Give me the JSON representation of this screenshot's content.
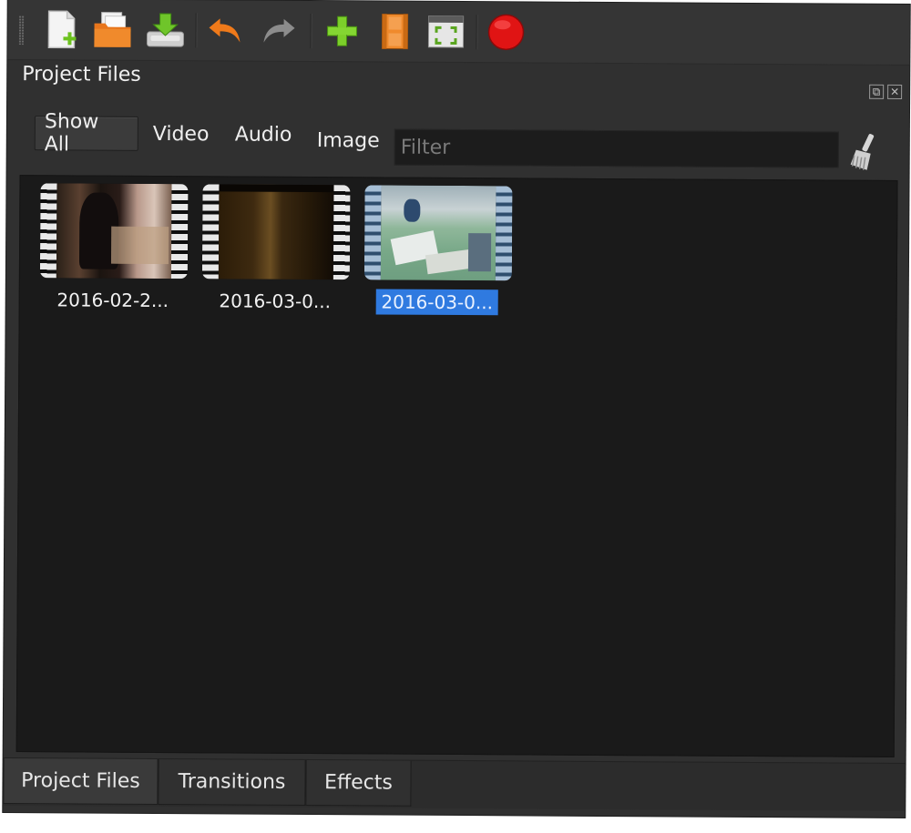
{
  "toolbar": {
    "buttons": [
      {
        "name": "new-project",
        "icon": "new-file-icon"
      },
      {
        "name": "open-project",
        "icon": "open-folder-icon"
      },
      {
        "name": "save-project",
        "icon": "save-download-icon"
      },
      {
        "name": "undo",
        "icon": "undo-arrow-icon"
      },
      {
        "name": "redo",
        "icon": "redo-arrow-icon"
      },
      {
        "name": "import-files",
        "icon": "plus-icon"
      },
      {
        "name": "choose-profile",
        "icon": "film-strip-icon"
      },
      {
        "name": "fullscreen",
        "icon": "fullscreen-icon"
      },
      {
        "name": "export-video",
        "icon": "record-icon"
      }
    ],
    "colors": {
      "accent_orange": "#f07a1a",
      "plus_green": "#7ccf2a",
      "record_red": "#e01414"
    }
  },
  "dock": {
    "title": "Project Files"
  },
  "filters": {
    "show_all": "Show All",
    "video": "Video",
    "audio": "Audio",
    "image": "Image",
    "placeholder": "Filter",
    "value": ""
  },
  "files": [
    {
      "label": "2016-02-2...",
      "selected": false
    },
    {
      "label": "2016-03-0...",
      "selected": false
    },
    {
      "label": "2016-03-0...",
      "selected": true
    }
  ],
  "tabs": [
    {
      "label": "Project Files",
      "active": true
    },
    {
      "label": "Transitions",
      "active": false
    },
    {
      "label": "Effects",
      "active": false
    }
  ],
  "colors": {
    "selection": "#2f7ae0",
    "panel_bg": "#1a1a1a",
    "window_bg": "#303030"
  }
}
